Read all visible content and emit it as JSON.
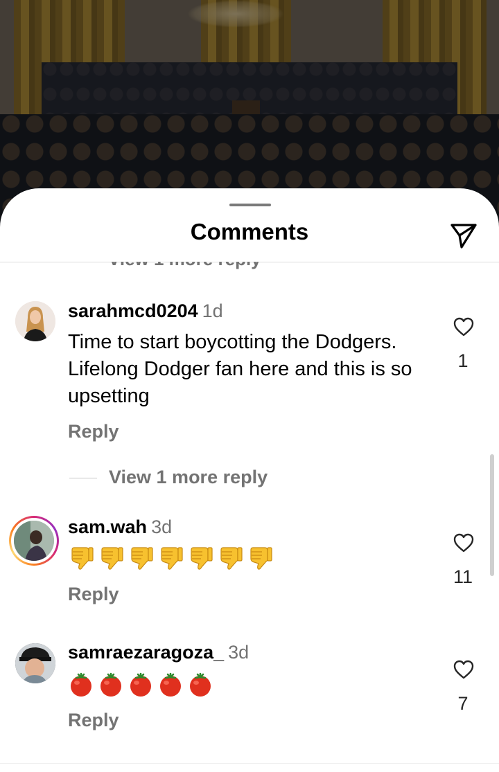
{
  "sheet": {
    "title": "Comments"
  },
  "clipped_view_more": "View 1 more reply",
  "comments": [
    {
      "username": "sarahmcd0204",
      "time": "1d",
      "text": "Time to start boycotting the Dodgers. Lifelong Dodger fan here and this is so upsetting",
      "reply_label": "Reply",
      "likes": "1",
      "view_more": "View 1 more reply"
    },
    {
      "username": "sam.wah",
      "time": "3d",
      "emoji": [
        "thumbs-down",
        "thumbs-down",
        "thumbs-down",
        "thumbs-down",
        "thumbs-down",
        "thumbs-down",
        "thumbs-down"
      ],
      "reply_label": "Reply",
      "likes": "11",
      "has_story_ring": true
    },
    {
      "username": "samraezaragoza_",
      "time": "3d",
      "emoji": [
        "tomato",
        "tomato",
        "tomato",
        "tomato",
        "tomato"
      ],
      "reply_label": "Reply",
      "likes": "7"
    }
  ],
  "colors": {
    "secondary_text": "#737373",
    "story_ring": "#d62976"
  }
}
